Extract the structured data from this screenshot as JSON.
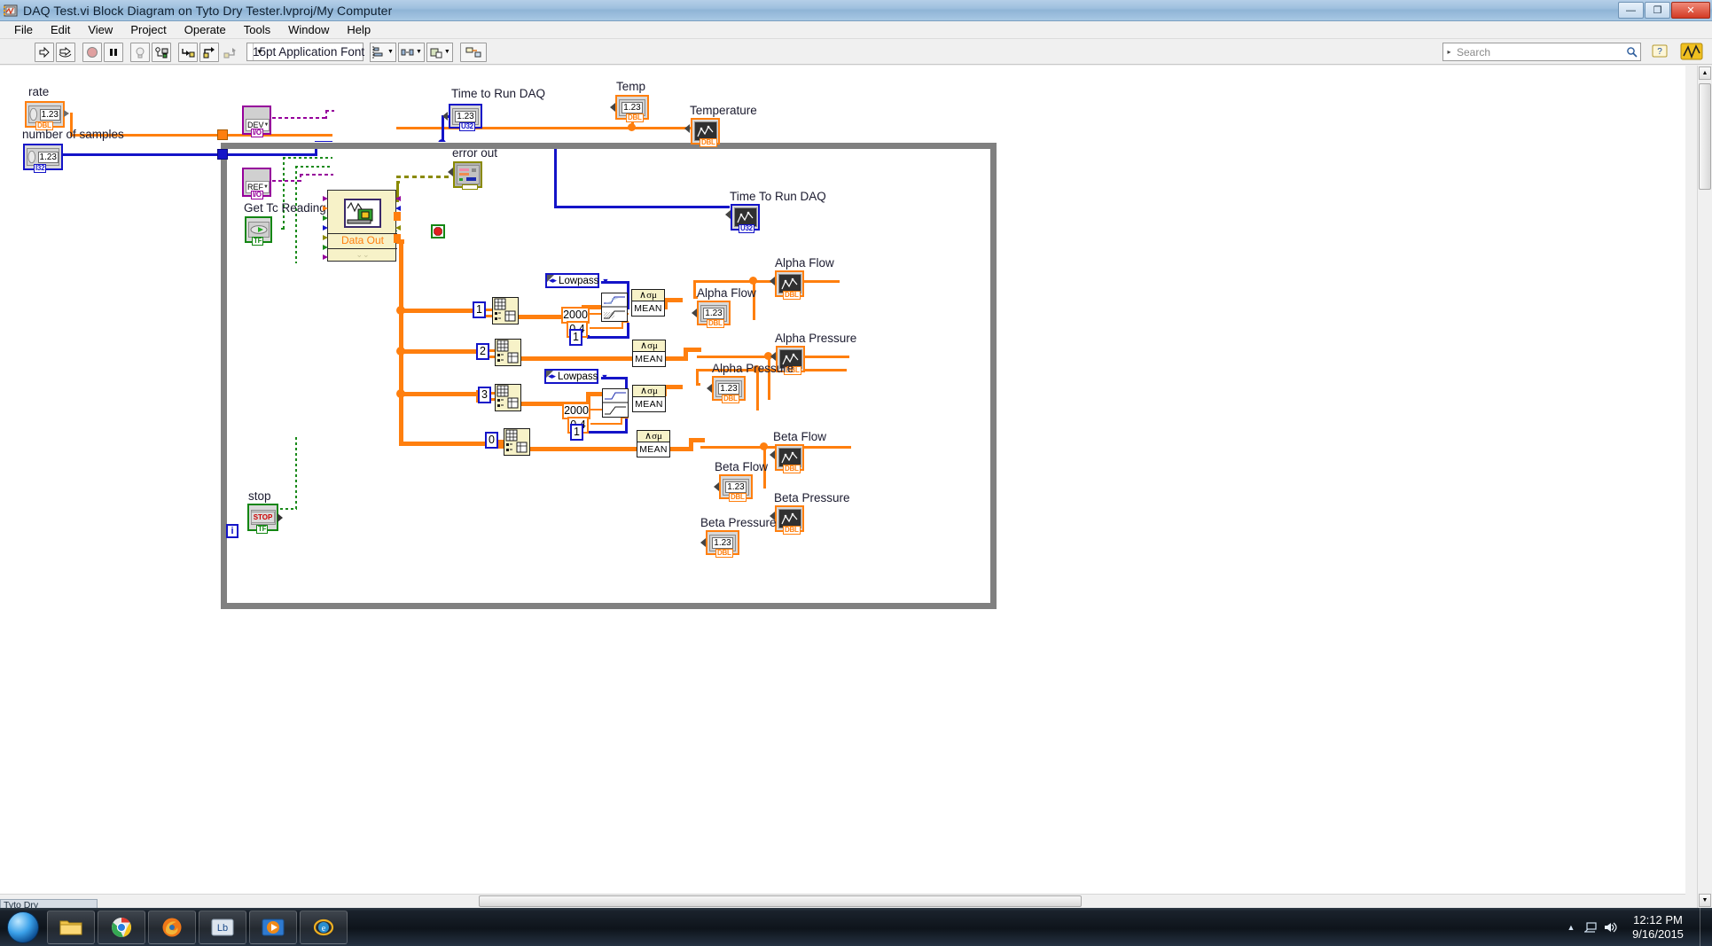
{
  "window": {
    "title": "DAQ Test.vi Block Diagram on Tyto Dry Tester.lvproj/My Computer",
    "icon": "labview-vi-icon",
    "minimize_label": "—",
    "maximize_label": "❐",
    "close_label": "✕"
  },
  "menu": {
    "items": [
      "File",
      "Edit",
      "View",
      "Project",
      "Operate",
      "Tools",
      "Window",
      "Help"
    ]
  },
  "toolbar": {
    "buttons": [
      {
        "name": "run-button",
        "icon": "run-arrow-icon"
      },
      {
        "name": "run-continuously-button",
        "icon": "run-continuously-icon"
      },
      {
        "name": "abort-execution-button",
        "icon": "abort-stop-icon"
      },
      {
        "name": "pause-button",
        "icon": "pause-icon"
      },
      {
        "name": "highlight-execution-button",
        "icon": "lightbulb-icon"
      },
      {
        "name": "retain-wire-values-button",
        "icon": "retain-wire-values-icon"
      },
      {
        "name": "step-into-button",
        "icon": "step-into-icon"
      },
      {
        "name": "step-over-button",
        "icon": "step-over-icon"
      },
      {
        "name": "step-out-button",
        "icon": "step-out-icon"
      }
    ],
    "font_selector": {
      "value": "15pt Application Font",
      "arrow": "▼"
    },
    "align_objects": {
      "name": "align-objects-button",
      "arrow": "▼"
    },
    "distribute_objects": {
      "name": "distribute-objects-button",
      "arrow": "▼"
    },
    "resize_objects": {
      "name": "resize-objects-button",
      "arrow": "▼"
    },
    "reorder": {
      "name": "reorder-button",
      "arrow": "▼"
    },
    "clean_up_diagram": {
      "name": "clean-up-diagram-button"
    }
  },
  "search": {
    "placeholder": "Search",
    "value": "",
    "arrow": "▸",
    "icon": "magnifier-icon"
  },
  "help_button": {
    "label": "?",
    "name": "context-help-button"
  },
  "diagram": {
    "structure": {
      "name": "while-loop",
      "iteration_terminal": "i",
      "conditional_terminal": "stop-sign"
    },
    "controls": [
      {
        "id": "rate",
        "label": "rate",
        "type_tag": "DBL",
        "value": "1.23",
        "color": "#ff7f0e"
      },
      {
        "id": "number_of_samples",
        "label": "number of samples",
        "type_tag": "I32",
        "value": "1.23",
        "color": "#1414c8"
      },
      {
        "id": "dev",
        "label": "DEV",
        "type_tag": "I/O",
        "value": "DEV",
        "color": "#96009b"
      },
      {
        "id": "ref",
        "label": "REF",
        "type_tag": "I/O",
        "value": "REF",
        "color": "#96009b"
      },
      {
        "id": "get_tc_reading",
        "label": "Get Tc Reading",
        "type_tag": "TF",
        "color": "#138613"
      },
      {
        "id": "stop",
        "label": "stop",
        "type_tag": "TF",
        "value": "STOP",
        "color": "#138613"
      }
    ],
    "subvi": {
      "name": "daq-subvi",
      "label": "Data Out",
      "expand_glyph": "⌄⌄"
    },
    "indicators": [
      {
        "id": "time_to_run_daq_num",
        "label": "Time to Run DAQ",
        "type_tag": "U32",
        "value": "1.23",
        "color": "#1414c8",
        "kind": "numeric"
      },
      {
        "id": "temp",
        "label": "Temp",
        "type_tag": "DBL",
        "value": "1.23",
        "color": "#ff7f0e",
        "kind": "numeric"
      },
      {
        "id": "temperature_graph",
        "label": "Temperature",
        "type_tag": "DBL",
        "color": "#ff7f0e",
        "kind": "graph"
      },
      {
        "id": "error_out",
        "label": "error out",
        "type_tag": "",
        "color": "#8a8a00",
        "kind": "cluster"
      },
      {
        "id": "time_to_run_daq_graph",
        "label": "Time To Run DAQ",
        "type_tag": "U32",
        "color": "#1414c8",
        "kind": "graph"
      },
      {
        "id": "alpha_flow_graph",
        "label": "Alpha Flow",
        "type_tag": "DBL",
        "color": "#ff7f0e",
        "kind": "graph"
      },
      {
        "id": "alpha_flow_num",
        "label": "Alpha Flow",
        "type_tag": "DBL",
        "value": "1.23",
        "color": "#ff7f0e",
        "kind": "numeric"
      },
      {
        "id": "alpha_pressure_graph",
        "label": "Alpha Pressure",
        "type_tag": "DBL",
        "color": "#ff7f0e",
        "kind": "graph"
      },
      {
        "id": "alpha_pressure_num",
        "label": "Alpha Pressure",
        "type_tag": "DBL",
        "value": "1.23",
        "color": "#ff7f0e",
        "kind": "numeric"
      },
      {
        "id": "beta_flow_graph",
        "label": "Beta Flow",
        "type_tag": "DBL",
        "color": "#ff7f0e",
        "kind": "graph"
      },
      {
        "id": "beta_flow_num",
        "label": "Beta Flow",
        "type_tag": "DBL",
        "value": "1.23",
        "color": "#ff7f0e",
        "kind": "numeric"
      },
      {
        "id": "beta_pressure_graph",
        "label": "Beta Pressure",
        "type_tag": "DBL",
        "color": "#ff7f0e",
        "kind": "graph"
      },
      {
        "id": "beta_pressure_num",
        "label": "Beta Pressure",
        "type_tag": "DBL",
        "value": "1.23",
        "color": "#ff7f0e",
        "kind": "numeric"
      }
    ],
    "constants": [
      {
        "id": "idx_1",
        "value": "1",
        "color": "#1414c8"
      },
      {
        "id": "idx_2",
        "value": "2",
        "color": "#1414c8"
      },
      {
        "id": "idx_3",
        "value": "3",
        "color": "#1414c8"
      },
      {
        "id": "idx_0",
        "value": "0",
        "color": "#1414c8"
      },
      {
        "id": "cutoff_top",
        "value": "2000",
        "color": "#ff7f0e"
      },
      {
        "id": "ripple_top",
        "value": "0.4",
        "color": "#ff7f0e"
      },
      {
        "id": "order_top",
        "value": "1",
        "color": "#1414c8"
      },
      {
        "id": "cutoff_bottom",
        "value": "2000",
        "color": "#ff7f0e"
      },
      {
        "id": "ripple_bottom",
        "value": "0.4",
        "color": "#ff7f0e"
      },
      {
        "id": "order_bottom",
        "value": "1",
        "color": "#1414c8"
      }
    ],
    "rings": [
      {
        "id": "filter_type_top",
        "value": "Lowpass",
        "left_glyph": "◂▸",
        "down_glyph": "▼"
      },
      {
        "id": "filter_type_bottom",
        "value": "Lowpass",
        "left_glyph": "◂▸",
        "down_glyph": "▼"
      }
    ],
    "functions": [
      {
        "id": "index_array_1",
        "name": "index-array-function"
      },
      {
        "id": "index_array_2",
        "name": "index-array-function"
      },
      {
        "id": "index_array_3",
        "name": "index-array-function"
      },
      {
        "id": "index_array_0",
        "name": "index-array-function"
      },
      {
        "id": "filter_top",
        "name": "filter-express-vi"
      },
      {
        "id": "filter_bottom",
        "name": "filter-express-vi"
      },
      {
        "id": "mean_1",
        "name": "amplitude-and-levels-vi",
        "top_label": "∧σμ",
        "bottom_label": "MEAN"
      },
      {
        "id": "mean_2",
        "name": "amplitude-and-levels-vi",
        "top_label": "∧σμ",
        "bottom_label": "MEAN"
      },
      {
        "id": "mean_3",
        "name": "amplitude-and-levels-vi",
        "top_label": "∧σμ",
        "bottom_label": "MEAN"
      },
      {
        "id": "mean_4",
        "name": "amplitude-and-levels-vi",
        "top_label": "∧σμ",
        "bottom_label": "MEAN"
      }
    ]
  },
  "taskbar": {
    "start_label": "Start",
    "quick_launch_tab": "Tyto Dry Tester.lvproj/My Computer",
    "items": [
      {
        "name": "taskbar-windows-explorer",
        "icon": "folder-icon"
      },
      {
        "name": "taskbar-google-chrome",
        "icon": "chrome-icon"
      },
      {
        "name": "taskbar-firefox",
        "icon": "firefox-icon"
      },
      {
        "name": "taskbar-labview",
        "icon": "labview-icon"
      },
      {
        "name": "taskbar-media-player",
        "icon": "media-player-icon"
      },
      {
        "name": "taskbar-ie",
        "icon": "internet-explorer-icon"
      }
    ],
    "tray": {
      "show_hidden": "▲",
      "network_icon": "network-icon",
      "volume_icon": "volume-icon"
    },
    "clock": {
      "time": "12:12 PM",
      "date": "9/16/2015"
    }
  }
}
